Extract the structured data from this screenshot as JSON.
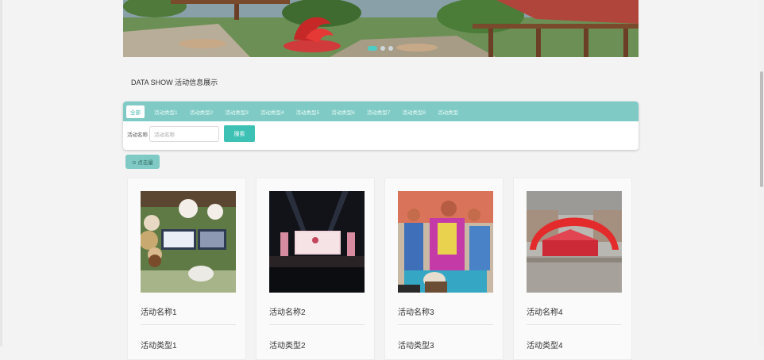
{
  "banner": {
    "slide_count": 3,
    "active_slide": 1
  },
  "section": {
    "title": "DATA SHOW 活动信息展示"
  },
  "filter": {
    "tabs": [
      "全部",
      "活动类型1",
      "活动类型2",
      "活动类型3",
      "活动类型4",
      "活动类型5",
      "活动类型6",
      "活动类型7",
      "活动类型8",
      "活动类型"
    ],
    "active_tab": "全部",
    "search_label": "活动名称",
    "search_placeholder": "活动名称",
    "search_button": "搜索"
  },
  "sort": {
    "label": "⊙ 点击量"
  },
  "cards": [
    {
      "name": "活动名称1",
      "type": "活动类型1"
    },
    {
      "name": "活动名称2",
      "type": "活动类型2"
    },
    {
      "name": "活动名称3",
      "type": "活动类型3"
    },
    {
      "name": "活动名称4",
      "type": "活动类型4"
    }
  ],
  "colors": {
    "accent": "#7fcac4",
    "button": "#3dc1b4"
  }
}
